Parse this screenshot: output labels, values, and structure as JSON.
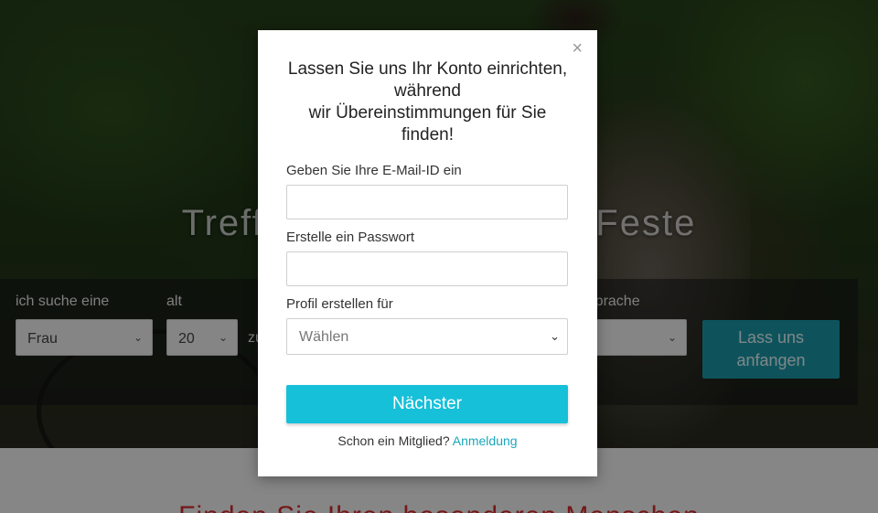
{
  "hero": {
    "title": "Treffen Sie Singles für Feste"
  },
  "search": {
    "seeking_label": "ich suche eine",
    "seeking_value": "Frau",
    "age_label": "alt",
    "age_from": "20",
    "age_between": "zu",
    "language_label": "Sprache",
    "language_value": "",
    "cta": "Lass uns anfangen"
  },
  "bottom": {
    "title": "Finden Sie Ihren besonderen Menschen"
  },
  "modal": {
    "title_line1": "Lassen Sie uns Ihr Konto einrichten,",
    "title_line2": "während",
    "title_line3": "wir Übereinstimmungen für Sie",
    "title_line4": "finden!",
    "email_label": "Geben Sie Ihre E-Mail-ID ein",
    "email_value": "",
    "password_label": "Erstelle ein Passwort",
    "password_value": "",
    "profile_label": "Profil erstellen für",
    "profile_placeholder": "Wählen",
    "next_button": "Nächster",
    "member_text": "Schon ein Mitglied?",
    "login_link": "Anmeldung",
    "close_symbol": "×"
  },
  "colors": {
    "primary": "#17c0d9",
    "cta_bg": "#1a98a8",
    "link": "#1ba6bd",
    "accent_red": "#d62b2b"
  },
  "icons": {
    "close": "close-icon",
    "chevron": "chevron-down-icon"
  }
}
